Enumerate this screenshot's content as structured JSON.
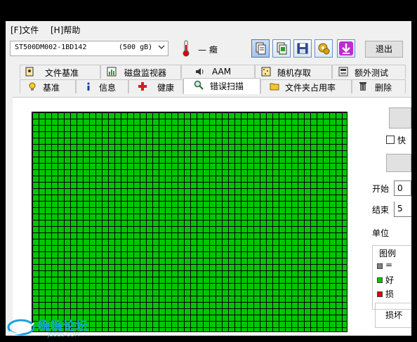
{
  "menu": {
    "file": "[F]文件",
    "help": "[H]帮助"
  },
  "toolbar": {
    "drive_name": "ST500DM002-1BD142",
    "drive_size": "(500 gB)",
    "temp_value": "— 癥",
    "exit_label": "退出"
  },
  "tabs_row1": [
    {
      "label": "文件基准",
      "icon": "file-benchmark-icon"
    },
    {
      "label": "磁盘监视器",
      "icon": "disk-monitor-icon"
    },
    {
      "label": "AAM",
      "icon": "speaker-icon"
    },
    {
      "label": "随机存取",
      "icon": "random-access-icon"
    },
    {
      "label": "额外测试",
      "icon": "extra-tests-icon"
    }
  ],
  "tabs_row2": [
    {
      "label": "基准",
      "icon": "lightbulb-icon"
    },
    {
      "label": "信息",
      "icon": "info-icon"
    },
    {
      "label": "健康",
      "icon": "health-cross-icon"
    },
    {
      "label": "错误扫描",
      "icon": "magnifier-icon"
    },
    {
      "label": "文件夹占用率",
      "icon": "folder-icon"
    },
    {
      "label": "删除",
      "icon": "trash-icon"
    }
  ],
  "side": {
    "quick_label": "快",
    "start_label": "开始",
    "start_value": "0",
    "end_label": "结束",
    "end_value": "5",
    "unit_label": "单位",
    "legend_title": "图例",
    "legend": [
      {
        "label": "=",
        "color": "#808080"
      },
      {
        "label": "好",
        "color": "#00c600"
      },
      {
        "label": "损",
        "color": "#e00000"
      }
    ],
    "damaged_label": "损坏"
  },
  "colors": {
    "block_good": "#00c600",
    "selected_tab_bg": "#ffffff"
  },
  "watermark": {
    "text": "嗨嗨论坛",
    "sub": "JBBBS.COM"
  }
}
